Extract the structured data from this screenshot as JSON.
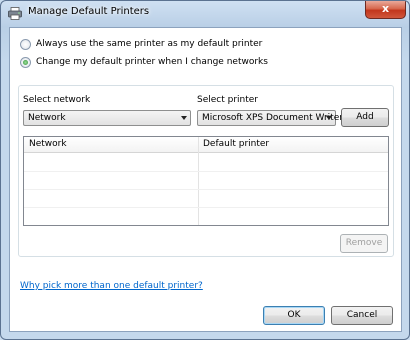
{
  "window": {
    "title": "Manage Default Printers",
    "close_label": "x"
  },
  "options": {
    "same_printer": {
      "label": "Always use the same printer as my default printer",
      "checked": false
    },
    "change_with_network": {
      "label": "Change my default printer when I change networks",
      "checked": true
    }
  },
  "network": {
    "label": "Select network",
    "value": "Network"
  },
  "printer": {
    "label": "Select printer",
    "value": "Microsoft XPS Document Writer"
  },
  "buttons": {
    "add": "Add",
    "remove": "Remove",
    "ok": "OK",
    "cancel": "Cancel"
  },
  "table": {
    "columns": [
      "Network",
      "Default printer"
    ],
    "rows": []
  },
  "help_link": "Why pick more than one default printer?"
}
